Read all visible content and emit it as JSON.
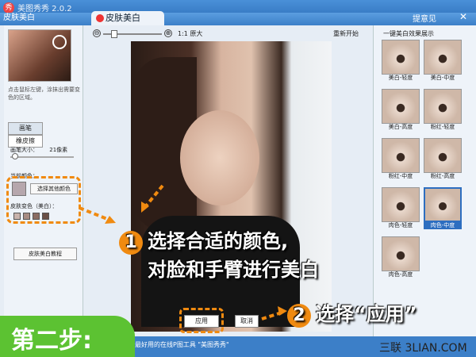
{
  "window": {
    "app_title": "美图秀秀 2.0.2",
    "tab_left": "皮肤美白",
    "active_tab": "皮肤美白",
    "help": "提意见",
    "close_glyph": "✕"
  },
  "toolbar": {
    "zoom_out": "⊖",
    "zoom_in": "⊕",
    "original_size": "1:1 原大",
    "restart": "重新开始"
  },
  "sidebar": {
    "hint": "点击鼠标左键，涂抹出需要变色的区域。",
    "brush_label": "画笔",
    "eraser_label": "橡皮擦",
    "brush_size_label": "画笔大小：",
    "brush_size_value": "21像素",
    "brush_size_fraction": 0.15,
    "current_color_label": "当前颜色：",
    "current_color": "#b6a7ad",
    "choose_color": "选择其他颜色",
    "skin_label": "皮肤变色（美白）：",
    "skin_colors": [
      "#c9b3ac",
      "#a78c83",
      "#8b6d63",
      "#6a5047"
    ],
    "tutorial": "皮肤美白教程"
  },
  "effects": {
    "title": "一键美白效果展示",
    "items": [
      {
        "label": "美白-轻度"
      },
      {
        "label": "美白-中度"
      },
      {
        "label": "美白-高度"
      },
      {
        "label": "粉红-轻度"
      },
      {
        "label": "粉红-中度"
      },
      {
        "label": "粉红-高度"
      },
      {
        "label": "肉色-轻度"
      },
      {
        "label": "肉色-中度"
      },
      {
        "label": "肉色-高度"
      }
    ],
    "selected_index": 7
  },
  "actions": {
    "apply": "应用",
    "undo": "取消"
  },
  "status": "最好用的在线P图工具 \"美图秀秀\"",
  "annotations": {
    "step": "第二步:",
    "note1_num": "1",
    "note1_line1": "选择合适的颜色,",
    "note1_line2": "对脸和手臂进行美白",
    "note2_num": "2",
    "note2_text": "选择“应用”",
    "watermark": "三联 3LIAN.COM"
  },
  "colors": {
    "accent": "#f08a10",
    "step_green": "#5cc232",
    "window_blue": "#2c6fb8"
  }
}
